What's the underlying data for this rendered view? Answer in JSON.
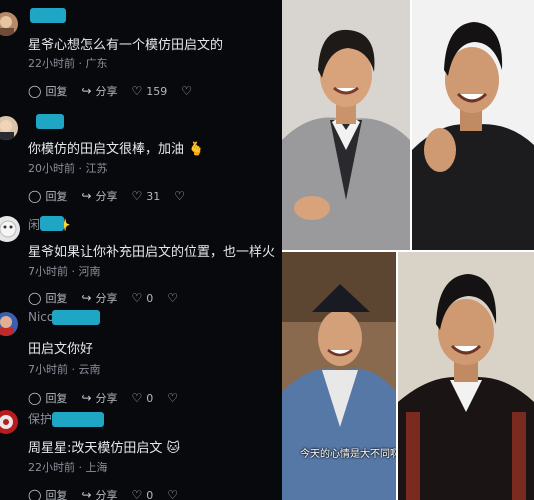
{
  "comments": [
    {
      "user": "",
      "text": "星爷心想怎么有一个模仿田启文的",
      "time": "22小时前",
      "location": "广东",
      "reply": "回复",
      "share": "分享",
      "likes": "159"
    },
    {
      "user": "",
      "text": "你模仿的田启文很棒，加油 🫰",
      "time": "20小时前",
      "location": "江苏",
      "reply": "回复",
      "share": "分享",
      "likes": "31"
    },
    {
      "user": "闲  哥✨",
      "text": "星爷如果让你补充田启文的位置，也一样火",
      "time": "7小时前",
      "location": "河南",
      "reply": "回复",
      "share": "分享",
      "likes": "0"
    },
    {
      "user": "Nico  ðø",
      "text": "田启文你好",
      "time": "7小时前",
      "location": "云南",
      "reply": "回复",
      "share": "分享",
      "likes": "0"
    },
    {
      "user": "保护",
      "text": "周星星:改天模仿田启文 🐱",
      "time": "22小时前",
      "location": "上海",
      "reply": "回复",
      "share": "分享",
      "likes": "0"
    }
  ],
  "photo_caption": "今天的心情是大不同啊",
  "colors": {
    "background": "#07090d",
    "accent": "#1fa6c4",
    "text": "#e8e8ea",
    "muted": "#8b8f99"
  },
  "icons": [
    "chat-bubble-icon",
    "share-arrow-icon",
    "heart-icon",
    "broken-heart-icon"
  ]
}
